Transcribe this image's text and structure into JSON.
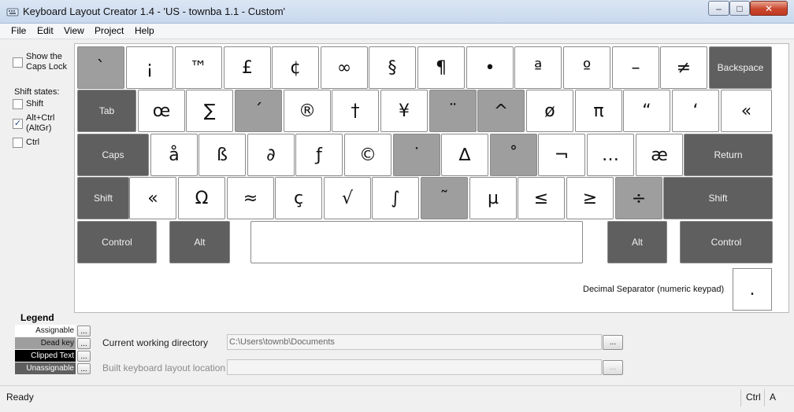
{
  "window": {
    "title": "Keyboard Layout Creator 1.4 - 'US - townba 1.1 - Custom'",
    "minimize": "–",
    "maximize": "□",
    "close": "✕"
  },
  "menu": [
    "File",
    "Edit",
    "View",
    "Project",
    "Help"
  ],
  "options": {
    "show_caps_lock": "Show the Caps Lock",
    "shift_states_label": "Shift states:",
    "shift": "Shift",
    "alt_ctrl": "Alt+Ctrl (AltGr)",
    "ctrl": "Ctrl",
    "check_mark": "✓",
    "checked": {
      "show_caps_lock": false,
      "shift": false,
      "alt_ctrl": true,
      "ctrl": false
    }
  },
  "keyboard": {
    "rows": [
      [
        {
          "label": "`",
          "kind": "dead"
        },
        {
          "label": "¡",
          "kind": "assignable"
        },
        {
          "label": "™",
          "kind": "assignable"
        },
        {
          "label": "£",
          "kind": "assignable"
        },
        {
          "label": "¢",
          "kind": "assignable"
        },
        {
          "label": "∞",
          "kind": "assignable"
        },
        {
          "label": "§",
          "kind": "assignable"
        },
        {
          "label": "¶",
          "kind": "assignable"
        },
        {
          "label": "•",
          "kind": "assignable"
        },
        {
          "label": "ª",
          "kind": "assignable"
        },
        {
          "label": "º",
          "kind": "assignable"
        },
        {
          "label": "–",
          "kind": "assignable"
        },
        {
          "label": "≠",
          "kind": "assignable"
        },
        {
          "label": "Backspace",
          "kind": "function"
        }
      ],
      [
        {
          "label": "Tab",
          "kind": "function"
        },
        {
          "label": "œ",
          "kind": "assignable"
        },
        {
          "label": "∑",
          "kind": "assignable"
        },
        {
          "label": "´",
          "kind": "dead"
        },
        {
          "label": "®",
          "kind": "assignable"
        },
        {
          "label": "†",
          "kind": "assignable"
        },
        {
          "label": "¥",
          "kind": "assignable"
        },
        {
          "label": "¨",
          "kind": "dead"
        },
        {
          "label": "^",
          "kind": "dead"
        },
        {
          "label": "ø",
          "kind": "assignable"
        },
        {
          "label": "π",
          "kind": "assignable"
        },
        {
          "label": "“",
          "kind": "assignable"
        },
        {
          "label": "‘",
          "kind": "assignable"
        },
        {
          "label": "«",
          "kind": "assignable"
        }
      ],
      [
        {
          "label": "Caps",
          "kind": "function"
        },
        {
          "label": "å",
          "kind": "assignable"
        },
        {
          "label": "ß",
          "kind": "assignable"
        },
        {
          "label": "∂",
          "kind": "assignable"
        },
        {
          "label": "ƒ",
          "kind": "assignable"
        },
        {
          "label": "©",
          "kind": "assignable"
        },
        {
          "label": "˙",
          "kind": "dead"
        },
        {
          "label": "∆",
          "kind": "assignable"
        },
        {
          "label": "˚",
          "kind": "dead"
        },
        {
          "label": "¬",
          "kind": "assignable"
        },
        {
          "label": "…",
          "kind": "assignable"
        },
        {
          "label": "æ",
          "kind": "assignable"
        },
        {
          "label": "Return",
          "kind": "function"
        }
      ],
      [
        {
          "label": "Shift",
          "kind": "function"
        },
        {
          "label": "«",
          "kind": "assignable"
        },
        {
          "label": "Ω",
          "kind": "assignable"
        },
        {
          "label": "≈",
          "kind": "assignable"
        },
        {
          "label": "ç",
          "kind": "assignable"
        },
        {
          "label": "√",
          "kind": "assignable"
        },
        {
          "label": "∫",
          "kind": "assignable"
        },
        {
          "label": "˜",
          "kind": "dead"
        },
        {
          "label": "µ",
          "kind": "assignable"
        },
        {
          "label": "≤",
          "kind": "assignable"
        },
        {
          "label": "≥",
          "kind": "assignable"
        },
        {
          "label": "÷",
          "kind": "dead"
        },
        {
          "label": "Shift",
          "kind": "function"
        }
      ],
      [
        {
          "label": "Control",
          "kind": "function"
        },
        {
          "label": "Alt",
          "kind": "function"
        },
        {
          "label": "",
          "kind": "assignable"
        },
        {
          "label": "Alt",
          "kind": "function"
        },
        {
          "label": "Control",
          "kind": "function"
        }
      ]
    ],
    "decimal_label": "Decimal Separator (numeric keypad)",
    "decimal_value": "."
  },
  "legend": {
    "title": "Legend",
    "items": [
      {
        "label": "Assignable",
        "bg": "#ffffff",
        "fg": "#111111"
      },
      {
        "label": "Dead key",
        "bg": "#9e9e9e",
        "fg": "#111111"
      },
      {
        "label": "Clipped Text",
        "bg": "#000000",
        "fg": "#ffffff"
      },
      {
        "label": "Unassignable",
        "bg": "#5f5f5f",
        "fg": "#ffffff"
      }
    ],
    "button_label": "..."
  },
  "paths": {
    "working_dir_label": "Current working directory",
    "working_dir_value": "C:\\Users\\townb\\Documents",
    "built_label": "Built keyboard layout location",
    "built_value": "",
    "browse_label": "..."
  },
  "status": {
    "text": "Ready",
    "ctrl": "Ctrl",
    "alt": "A"
  },
  "colors": {
    "function_key": "#5f5f5f",
    "dead_key": "#9e9e9e",
    "assignable_key": "#ffffff"
  }
}
